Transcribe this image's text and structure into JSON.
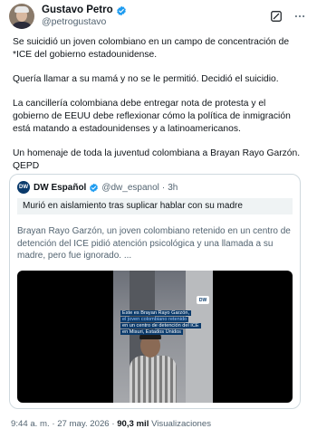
{
  "author": {
    "display_name": "Gustavo Petro",
    "handle": "@petrogustavo",
    "verified": true,
    "avatar_icon": "avatar-photo",
    "verified_color": "#1d9bf0"
  },
  "header_actions": [
    "grok-icon",
    "more-options-icon"
  ],
  "tweet": {
    "paragraphs": [
      "Se suicidió un joven colombiano en un campo de concentración de *ICE del gobierno estadounidense.",
      "Quería llamar a su mamá y no se le permitió. Decidió el suicidio.",
      "La cancillería colombiana debe entregar nota de protesta y el gobierno de EEUU debe reflexionar cómo la política de inmigración está matando a estadounidenses y a latinoamericanos.",
      "Un homenaje de toda la juventud colombiana a Brayan Rayo Garzón. QEPD"
    ]
  },
  "quote": {
    "name": "DW Español",
    "logo_text": "DW",
    "handle": "@dw_espanol",
    "separator": "·",
    "time": "3h",
    "headline": "Murió en aislamiento tras suplicar hablar con su madre",
    "text": "Brayan Rayo Garzón, un joven colombiano retenido en un centro de detención del ICE pidió atención psicológica y una llamada a su madre, pero fue ignorado. ...",
    "video": {
      "badge": "DW",
      "caption_lines": [
        "Este es Brayan Rayo Garzón,",
        "el joven colombiano retenido",
        "en un centro de detención del ICE",
        "en Misuri, Estados Unidos"
      ]
    }
  },
  "meta": {
    "time": "9:44 a. m.",
    "separator": "·",
    "date": "27 may. 2026",
    "views_count": "90,3 mil",
    "views_label": "Visualizaciones"
  }
}
